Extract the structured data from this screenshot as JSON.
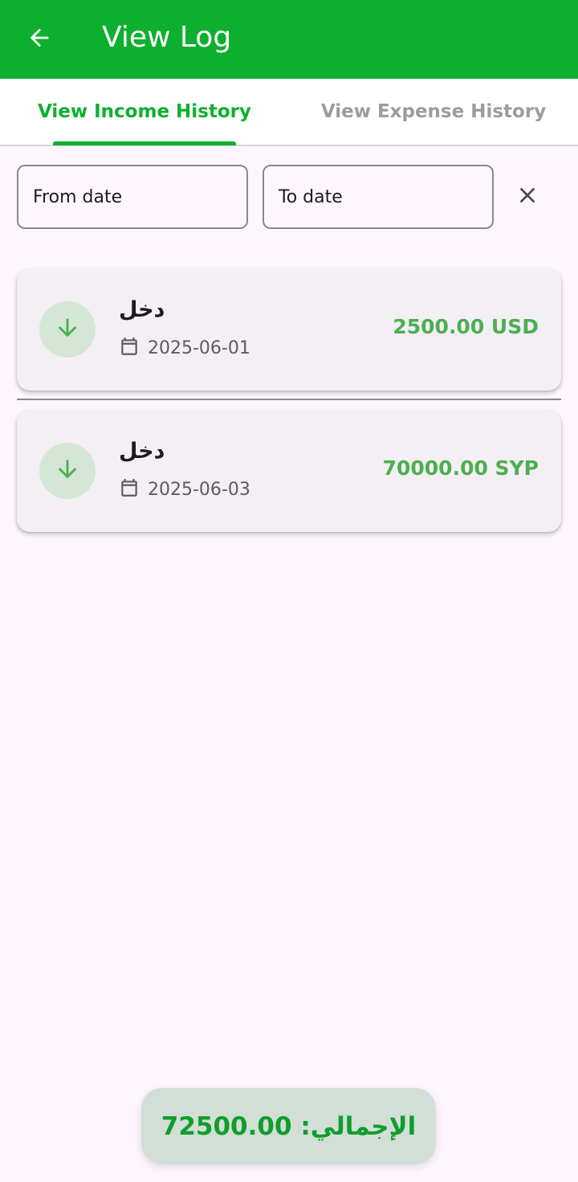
{
  "appbar": {
    "title": "View Log",
    "back_icon": "arrow-left-icon",
    "color": "#0db02e"
  },
  "tabs": [
    {
      "label": "View Income History",
      "active": true
    },
    {
      "label": "View Expense History",
      "active": false
    }
  ],
  "filters": {
    "from_placeholder": "From date",
    "to_placeholder": "To date",
    "clear_icon": "close-icon"
  },
  "transactions": [
    {
      "title": "دخل",
      "date": "2025-06-01",
      "amount": "2500.00 USD",
      "icon": "arrow-down-icon"
    },
    {
      "title": "دخل",
      "date": "2025-06-03",
      "amount": "70000.00 SYP",
      "icon": "arrow-down-icon"
    }
  ],
  "total": {
    "text": "الإجمالي: 72500.00"
  },
  "colors": {
    "accent": "#0db02e",
    "amount": "#4caf50",
    "card_bg": "#f3eff5",
    "page_bg": "#fdf7fd"
  }
}
